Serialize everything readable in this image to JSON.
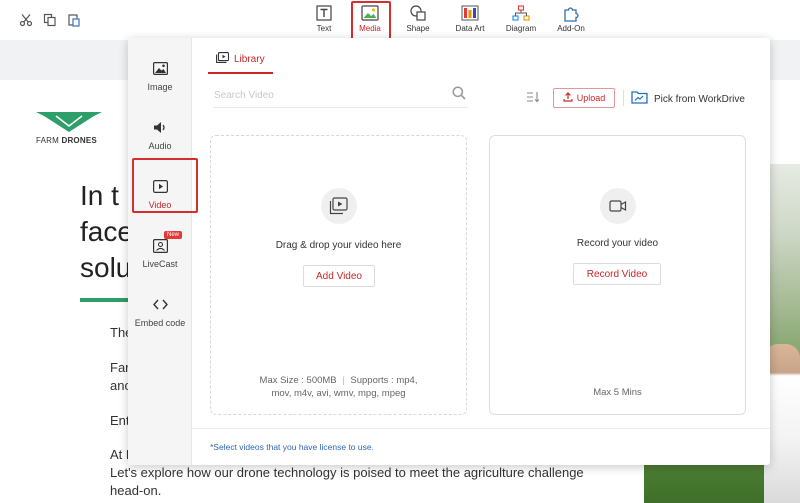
{
  "toolbar": {
    "items": [
      {
        "label": "Text",
        "icon": "text-box-icon"
      },
      {
        "label": "Media",
        "icon": "image-icon",
        "active": true
      },
      {
        "label": "Shape",
        "icon": "shape-icon"
      },
      {
        "label": "Data Art",
        "icon": "bar-chart-icon"
      },
      {
        "label": "Diagram",
        "icon": "diagram-icon"
      },
      {
        "label": "Add-On",
        "icon": "puzzle-icon"
      }
    ],
    "left_icons": [
      "cut-icon",
      "copy-icon",
      "paste-icon"
    ]
  },
  "document": {
    "logo_text_light": "FARM",
    "logo_text_bold": "DRONES",
    "heading_lines": [
      "In t",
      "face",
      "solu"
    ],
    "paragraphs": [
      "The",
      "Far",
      "anc",
      "Ent",
      "At F"
    ],
    "paragraph_full_1": "Let's explore how our drone technology is poised to meet the agriculture challenge",
    "paragraph_full_2": "head-on."
  },
  "dialog": {
    "sidebar": [
      {
        "label": "Image",
        "icon": "image-icon"
      },
      {
        "label": "Audio",
        "icon": "speaker-icon"
      },
      {
        "label": "Video",
        "icon": "video-play-icon",
        "active": true
      },
      {
        "label": "LiveCast",
        "icon": "livecast-icon",
        "badge": "New"
      },
      {
        "label": "Embed code",
        "icon": "code-icon"
      }
    ],
    "tab_label": "Library",
    "search_placeholder": "Search Video",
    "upload_label": "Upload",
    "workdrive_label": "Pick from WorkDrive",
    "upload_card": {
      "title": "Drag & drop your video here",
      "button": "Add Video",
      "note_line1": "Max Size : 500MB",
      "note_line1b": "Supports : mp4,",
      "note_line2": "mov, m4v, avi, wmv, mpg, mpeg"
    },
    "record_card": {
      "title": "Record your video",
      "button": "Record Video",
      "note": "Max 5 Mins"
    },
    "footer_note": "*Select videos that you have license to use."
  },
  "colors": {
    "accent": "#c62828",
    "highlight_box": "#d32f2f",
    "brand_green": "#2e9e6a",
    "link_blue": "#2f67b1"
  }
}
